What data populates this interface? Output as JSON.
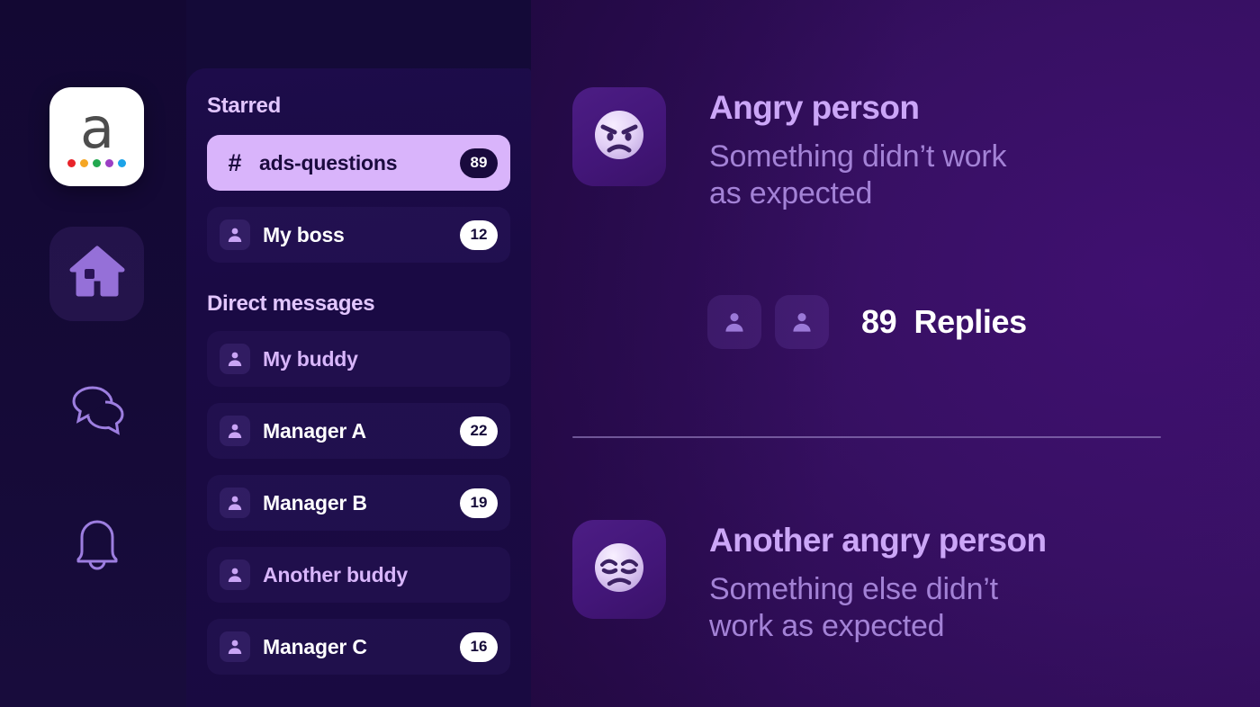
{
  "app": {
    "logo": {
      "letter": "a",
      "icon": "app-logo-icon",
      "dot_colors": [
        "#e8232a",
        "#f5a623",
        "#22a84f",
        "#9b3fc4",
        "#1ca3e8"
      ]
    },
    "accent": "#d9b4fb",
    "background": "#140a38"
  },
  "rail": {
    "items": [
      {
        "id": "home",
        "icon": "home-icon",
        "label": "Home",
        "active": true
      },
      {
        "id": "chats",
        "icon": "chat-bubbles-icon",
        "label": "Chats",
        "active": false
      },
      {
        "id": "notifications",
        "icon": "bell-icon",
        "label": "Notifications",
        "active": false
      }
    ]
  },
  "sidebar": {
    "sections": [
      {
        "title": "Starred",
        "items": [
          {
            "name": "ads-questions",
            "icon": "hash-icon",
            "badge": "89",
            "selected": true,
            "read": false
          },
          {
            "name": "My boss",
            "icon": "person-icon",
            "badge": "12",
            "selected": false,
            "read": false
          }
        ]
      },
      {
        "title": "Direct messages",
        "items": [
          {
            "name": "My buddy",
            "icon": "person-icon",
            "badge": "",
            "selected": false,
            "read": true
          },
          {
            "name": "Manager A",
            "icon": "person-icon",
            "badge": "22",
            "selected": false,
            "read": false
          },
          {
            "name": "Manager B",
            "icon": "person-icon",
            "badge": "19",
            "selected": false,
            "read": false
          },
          {
            "name": "Another buddy",
            "icon": "person-icon",
            "badge": "",
            "selected": false,
            "read": true
          },
          {
            "name": "Manager C",
            "icon": "person-icon",
            "badge": "16",
            "selected": false,
            "read": false
          }
        ]
      }
    ]
  },
  "threads": [
    {
      "emoji": "angry-face-emoji",
      "title": "Angry person",
      "message_line1": "Something didn’t work",
      "message_line2": "as expected",
      "replies_count": "89",
      "replies_label": "Replies",
      "participants": [
        "person-icon",
        "person-icon"
      ]
    },
    {
      "emoji": "unamused-face-emoji",
      "title": "Another angry person",
      "message_line1": "Something else didn’t",
      "message_line2": "work as expected",
      "replies_count": "",
      "replies_label": ""
    }
  ]
}
